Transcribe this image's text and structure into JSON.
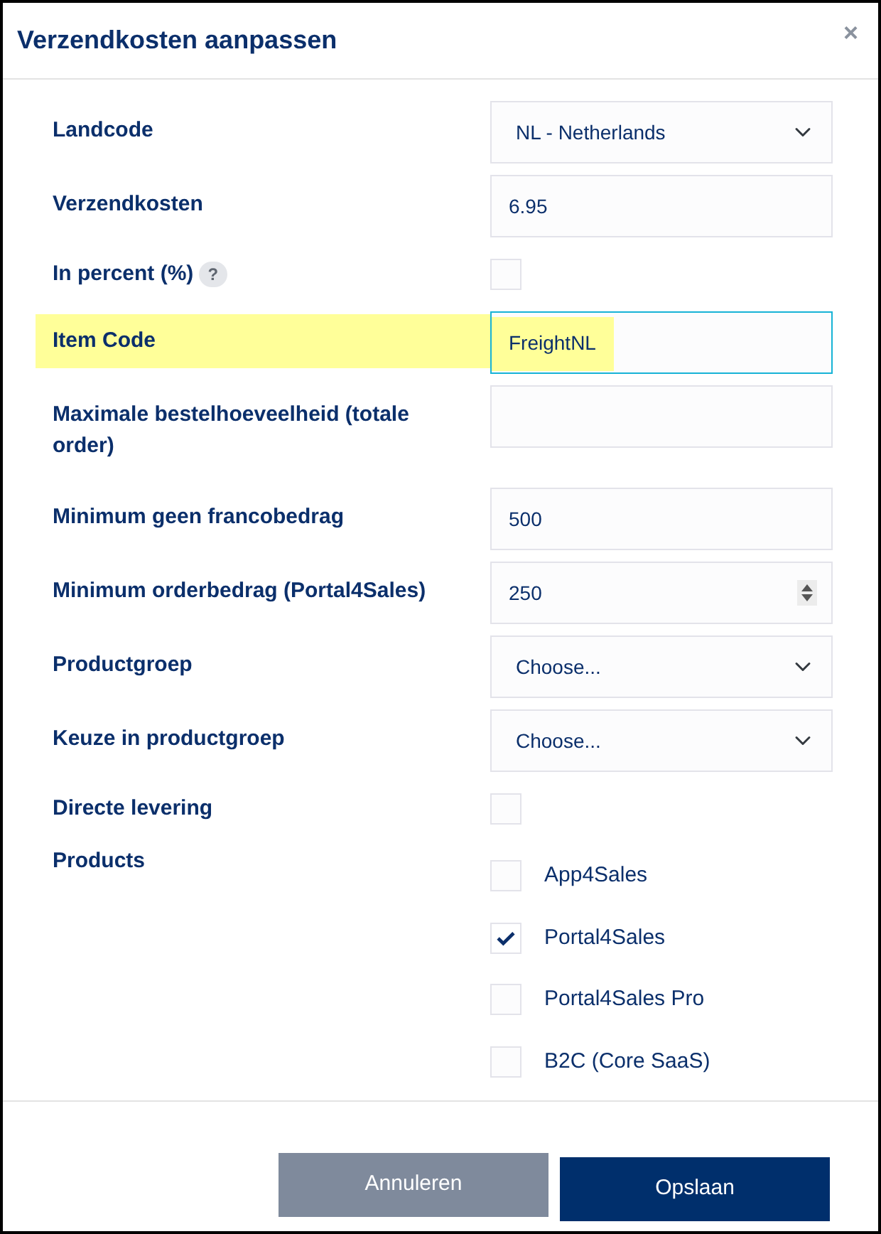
{
  "dialog": {
    "title": "Verzendkosten aanpassen",
    "close": "×"
  },
  "fields": [
    {
      "kind": "select",
      "label": "Landcode",
      "value": "NL - Netherlands"
    },
    {
      "kind": "text",
      "label": "Verzendkosten",
      "value": "6.95"
    },
    {
      "kind": "checkbox",
      "label": "In percent (%)",
      "help": "?",
      "checked": false
    },
    {
      "kind": "text",
      "label": "Item Code",
      "value": "FreightNL",
      "focused": true,
      "highlighted": true
    },
    {
      "kind": "text",
      "label": "Maximale bestelhoeveelheid (totale order)"
    },
    {
      "kind": "text",
      "label": "Minimum geen francobedrag",
      "value": "500"
    },
    {
      "kind": "number",
      "label": "Minimum orderbedrag (Portal4Sales)",
      "value": "250"
    },
    {
      "kind": "select",
      "label": "Productgroep",
      "value": "Choose..."
    },
    {
      "kind": "select",
      "label": "Keuze in productgroep",
      "value": "Choose..."
    },
    {
      "kind": "checkbox",
      "label": "Directe levering",
      "checked": false
    },
    {
      "kind": "checklist",
      "label": "Products",
      "options": [
        {
          "label": "App4Sales",
          "checked": false
        },
        {
          "label": "Portal4Sales",
          "checked": true
        },
        {
          "label": "Portal4Sales Pro",
          "checked": false
        },
        {
          "label": "B2C (Core SaaS)",
          "checked": false
        }
      ]
    }
  ],
  "buttons": [
    {
      "label": "Annuleren",
      "kind": "secondary"
    },
    {
      "label": "Opslaan",
      "kind": "primary"
    }
  ]
}
